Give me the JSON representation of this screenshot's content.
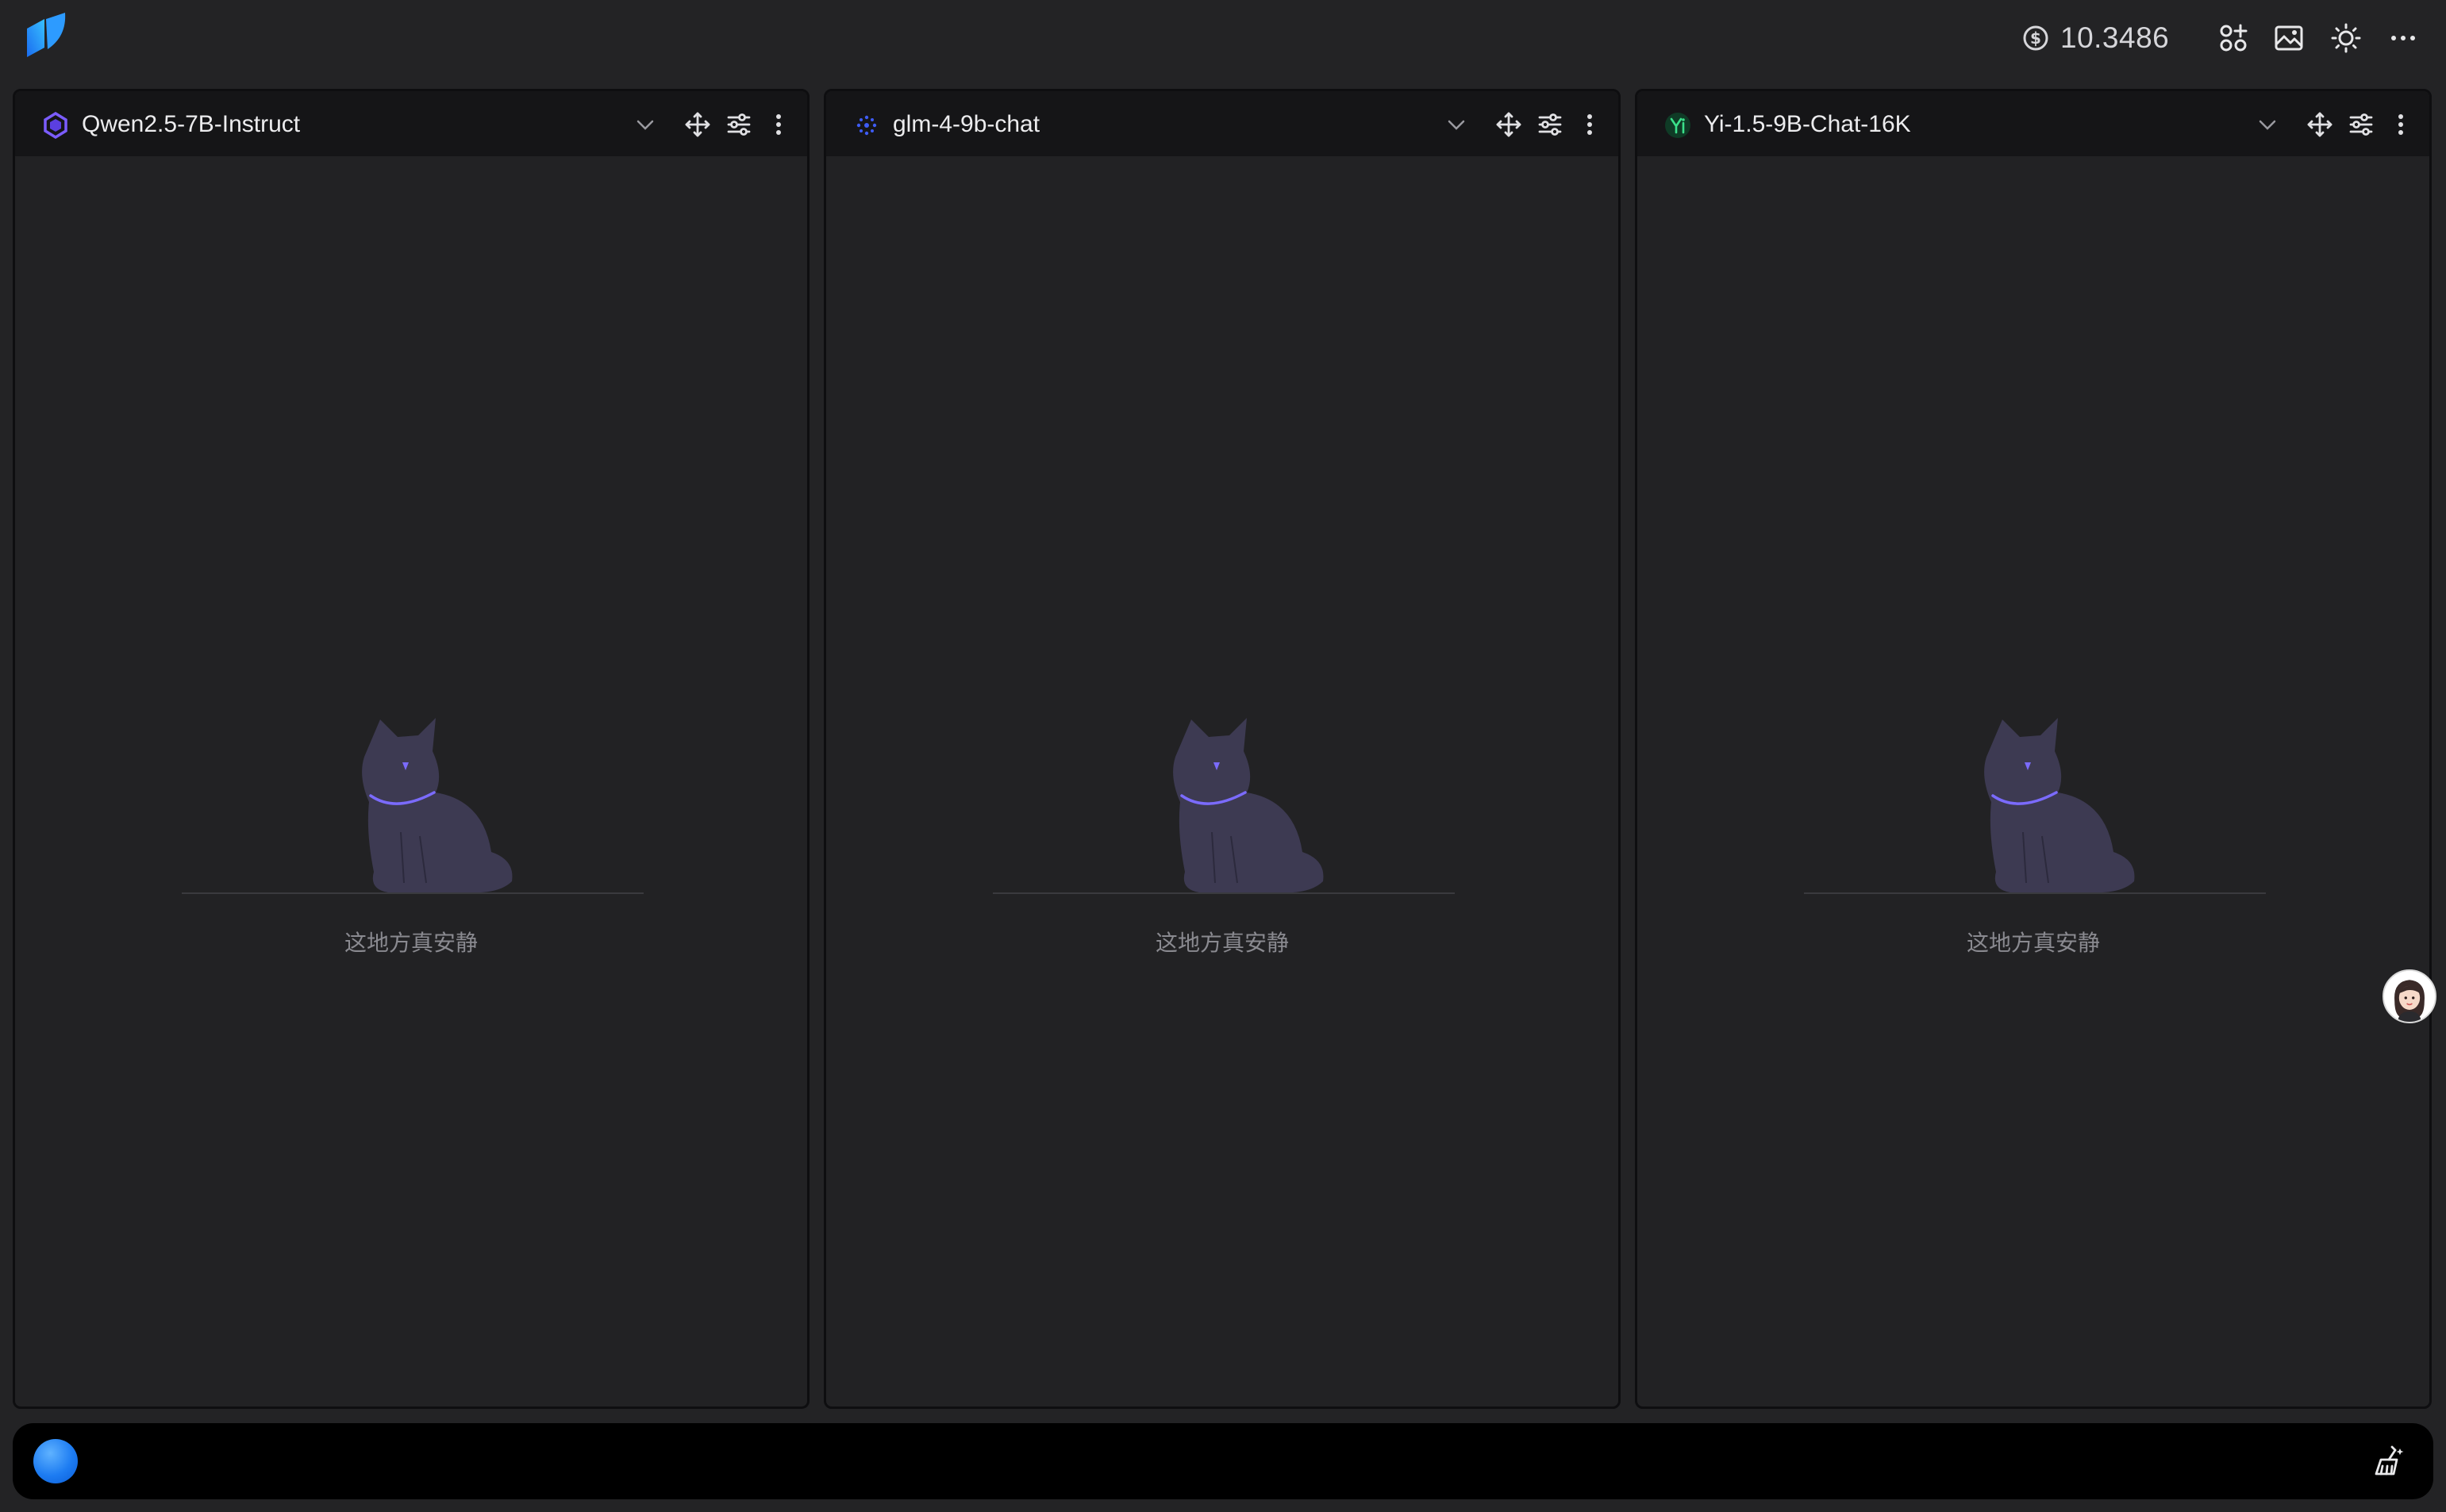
{
  "topbar": {
    "logo_icon": "app-logo-icon",
    "balance": "10.3486",
    "balance_icon": "coin-dollar-icon",
    "icons": [
      "apps-plus-icon",
      "image-gallery-icon",
      "sun-theme-icon",
      "more-horizontal-icon"
    ]
  },
  "panels": [
    {
      "model_name": "Qwen2.5-7B-Instruct",
      "model_icon": "qwen-logo-icon",
      "empty_text": "这地方真安静"
    },
    {
      "model_name": "glm-4-9b-chat",
      "model_icon": "zhipu-logo-icon",
      "empty_text": "这地方真安静"
    },
    {
      "model_name": "Yi-1.5-9B-Chat-16K",
      "model_icon": "yi-logo-icon",
      "empty_text": "这地方真安静"
    }
  ],
  "panel_buttons": [
    "chevron-down-icon",
    "move-arrows-icon",
    "sliders-icon",
    "more-vertical-icon"
  ],
  "input": {
    "value": "",
    "placeholder": ""
  },
  "colors": {
    "background": "#232325",
    "panel_header": "#151517",
    "accent_blue": "#1d7cf2",
    "cat_body": "#3d3a52",
    "cat_accent": "#7b6bff"
  }
}
